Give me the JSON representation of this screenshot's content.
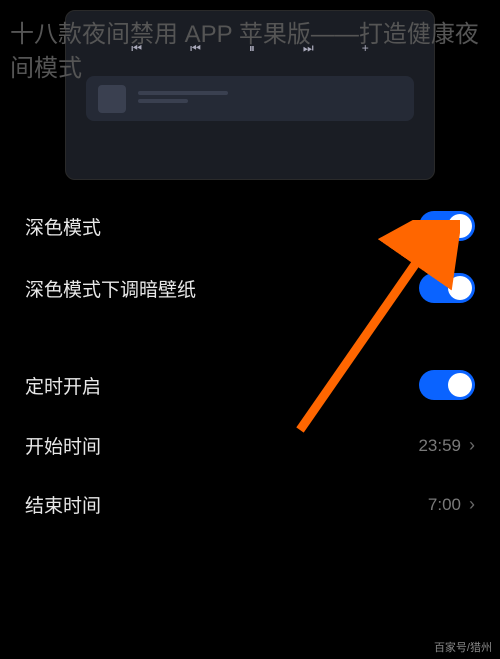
{
  "article": {
    "title": "十八款夜间禁用 APP 苹果版——打造健康夜间模式"
  },
  "mediaControls": {
    "prev": "⏮",
    "prev2": "⏮",
    "pause": "⏸",
    "next": "⏭",
    "plus": "+"
  },
  "settings": {
    "darkMode": {
      "label": "深色模式"
    },
    "dimWallpaper": {
      "label": "深色模式下调暗壁纸"
    },
    "scheduled": {
      "label": "定时开启"
    },
    "startTime": {
      "label": "开始时间",
      "value": "23:59"
    },
    "endTime": {
      "label": "结束时间",
      "value": "7:00"
    }
  },
  "watermark": "百家号/猎州"
}
